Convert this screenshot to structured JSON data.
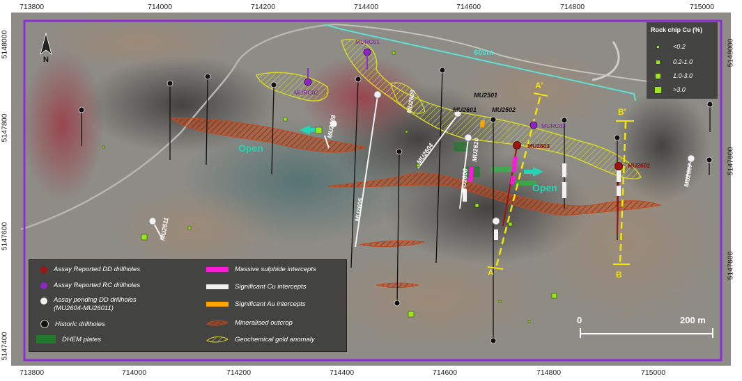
{
  "map": {
    "x_ticks": [
      "713800",
      "714000",
      "714200",
      "714400",
      "714600",
      "714800",
      "715000"
    ],
    "y_ticks": [
      "5148000",
      "5147800",
      "5147600",
      "5147400"
    ],
    "north_label": "N",
    "distance_label": "600m",
    "open_label": "Open",
    "section_labels": {
      "a_prime": "A'",
      "b_prime": "B'",
      "a": "A",
      "b": "B"
    },
    "drillholes": {
      "rc": [
        "MURC01",
        "MURC02",
        "MURC03"
      ],
      "dd_reported": [
        "MU2603",
        "MU2602"
      ],
      "pending": [
        "MU2608",
        "MU2605",
        "MU2604",
        "MU2609",
        "MU2601",
        "MU2501",
        "MU2502",
        "MU2606",
        "MU2610",
        "MU2607",
        "MU2611"
      ]
    },
    "scale": {
      "start": "0",
      "end": "200 m"
    },
    "colors": {
      "boundary": "#8f2bd9",
      "massive_sulphide": "#ff1ad9",
      "cu_intercepts": "#f2f2f2",
      "au_intercepts": "#ffa500",
      "outcrop": "#c24a1e",
      "gold_anomaly": "#d6d62a",
      "dhem": "#1f7a2c",
      "section_line": "#f5e600",
      "distance_line": "#5ee0d4"
    }
  },
  "legend": {
    "items": [
      {
        "label": "Assay Reported DD drillholes",
        "symbol": "red-dot"
      },
      {
        "label": "Assay Reported RC drillholes",
        "symbol": "purple-dot"
      },
      {
        "label": "Assay pending DD drillholes\n(MU2604-MU26011)",
        "symbol": "white-dot"
      },
      {
        "label": "Historic drillholes",
        "symbol": "black-dot"
      },
      {
        "label": "DHEM plates",
        "symbol": "green-rect"
      },
      {
        "label": "Massive sulphide intercepts",
        "symbol": "magenta-bar"
      },
      {
        "label": "Significant Cu intercepts",
        "symbol": "white-bar"
      },
      {
        "label": "Significant Au intercepts",
        "symbol": "orange-bar"
      },
      {
        "label": "Mineralised outcrop",
        "symbol": "hatched-brown"
      },
      {
        "label": "Geochemical gold anomaly",
        "symbol": "hatched-yellow"
      }
    ]
  },
  "rock_chip_legend": {
    "title": "Rock chip Cu (%)",
    "items": [
      "<0.2",
      "0.2-1.0",
      "1.0-3.0",
      ">3.0"
    ]
  }
}
